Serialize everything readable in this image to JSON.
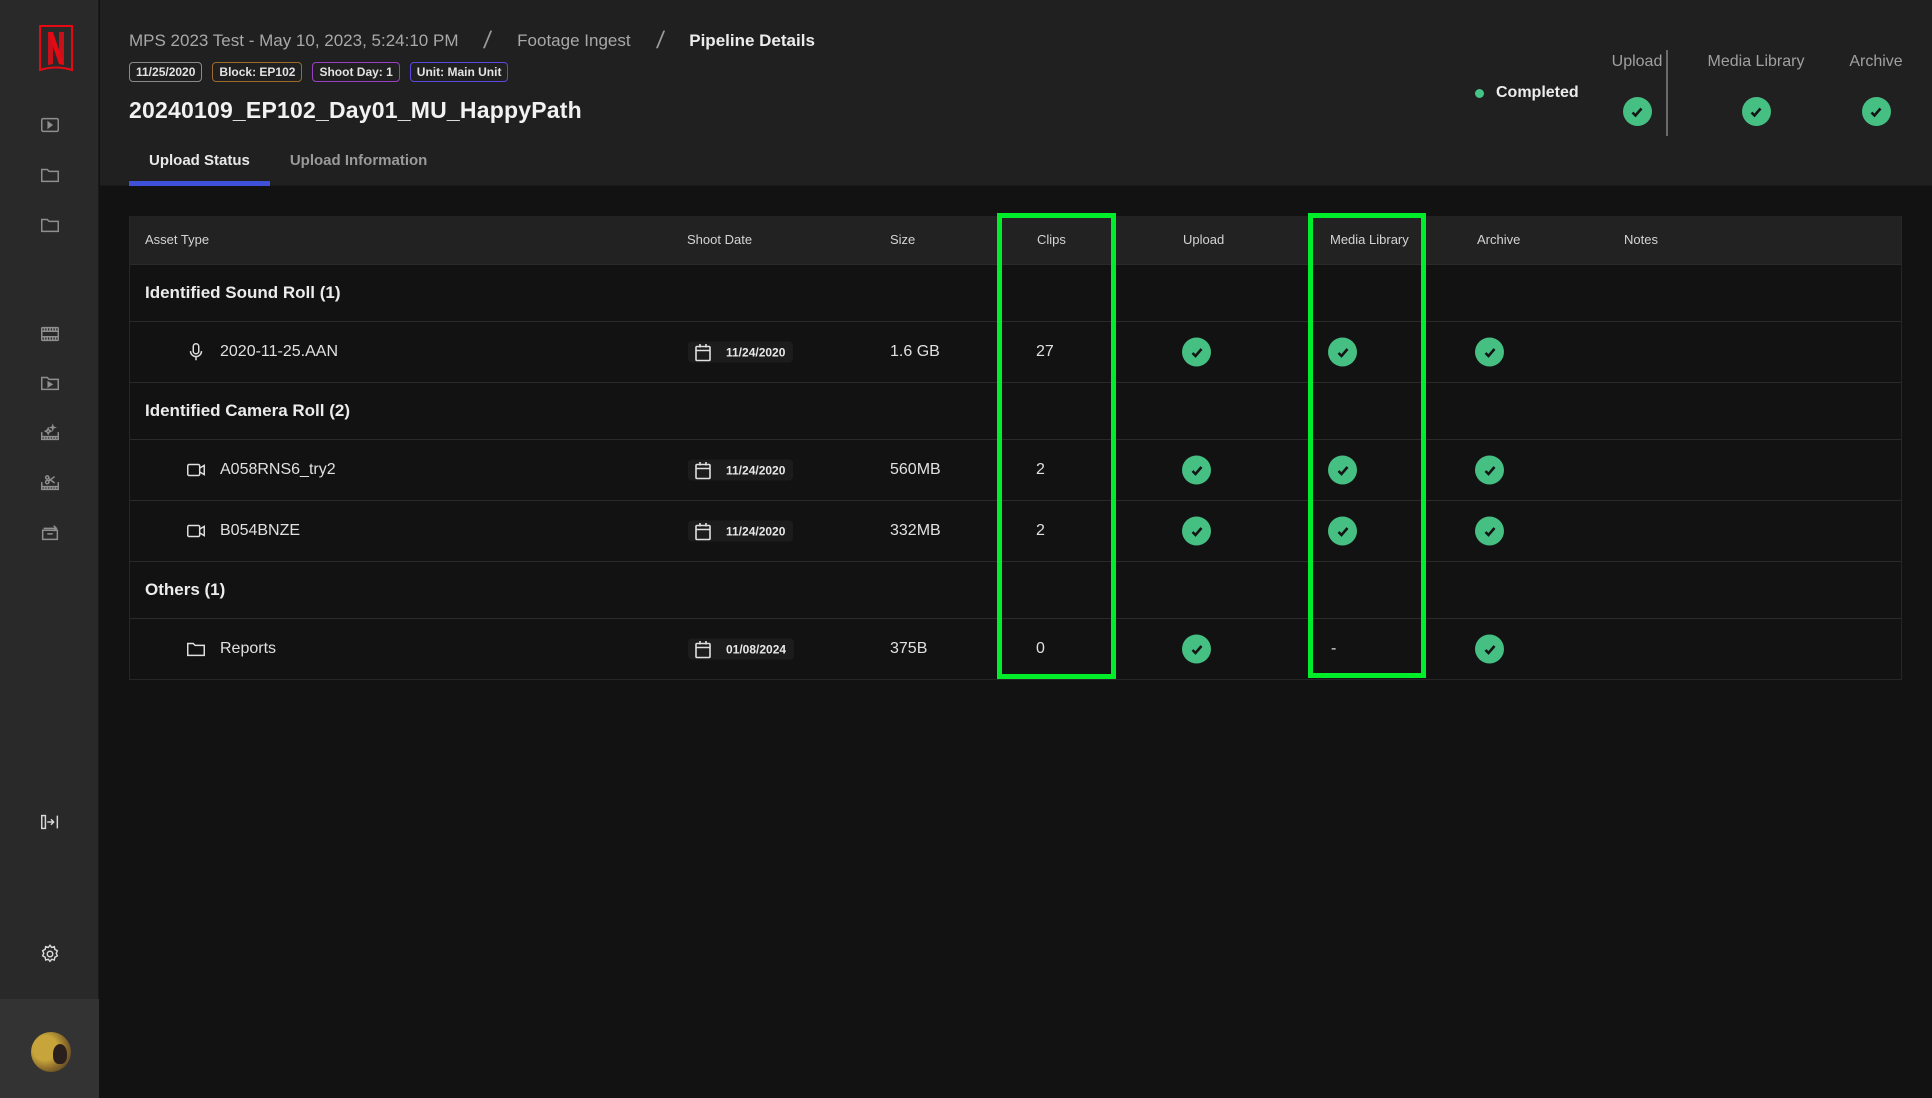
{
  "sidebar": {
    "logo": "netflix-logo",
    "items": [
      {
        "name": "sidebar-item-player",
        "icon": "play-square-icon"
      },
      {
        "name": "sidebar-item-folder-1",
        "icon": "folder-icon"
      },
      {
        "name": "sidebar-item-folder-2",
        "icon": "folder-icon"
      },
      {
        "name": "sidebar-item-film",
        "icon": "film-strip-icon"
      },
      {
        "name": "sidebar-item-media-folder",
        "icon": "folder-play-icon"
      },
      {
        "name": "sidebar-item-vfx",
        "icon": "film-sparkle-icon"
      },
      {
        "name": "sidebar-item-edit",
        "icon": "film-scissors-icon"
      },
      {
        "name": "sidebar-item-archive",
        "icon": "archive-arrow-icon"
      }
    ],
    "expand_icon": "expand-sidebar-icon",
    "settings_icon": "gear-icon",
    "avatar": "user-avatar"
  },
  "header": {
    "breadcrumb": [
      "MPS 2023 Test - May 10, 2023, 5:24:10 PM",
      "Footage Ingest",
      "Pipeline Details"
    ],
    "breadcrumb_separator": "/",
    "badges": [
      {
        "label": "11/25/2020",
        "color": "#8a8a8a"
      },
      {
        "label": "Block: EP102",
        "color": "#9a6a2a"
      },
      {
        "label": "Shoot Day: 1",
        "color": "#9a3fc4"
      },
      {
        "label": "Unit: Main Unit",
        "color": "#5a48e0"
      }
    ],
    "title": "20240109_EP102_Day01_MU_HappyPath",
    "tabs": [
      {
        "label": "Upload Status",
        "active": true
      },
      {
        "label": "Upload Information",
        "active": false
      }
    ],
    "status": {
      "label": "Completed",
      "color": "#44c487"
    },
    "stages": [
      {
        "label": "Upload",
        "state": "complete"
      },
      {
        "label": "Media Library",
        "state": "complete"
      },
      {
        "label": "Archive",
        "state": "complete"
      }
    ]
  },
  "table": {
    "columns": [
      "Asset Type",
      "Shoot Date",
      "Size",
      "Clips",
      "Upload",
      "Media Library",
      "Archive",
      "Notes"
    ],
    "groups": [
      {
        "label": "Identified Sound Roll (1)",
        "items": [
          {
            "icon": "microphone-icon",
            "name": "2020-11-25.AAN",
            "shoot_date": "11/24/2020",
            "size": "1.6 GB",
            "clips": "27",
            "upload": "complete",
            "media_library": "complete",
            "archive": "complete",
            "notes": ""
          }
        ]
      },
      {
        "label": "Identified Camera Roll (2)",
        "items": [
          {
            "icon": "video-camera-icon",
            "name": "A058RNS6_try2",
            "shoot_date": "11/24/2020",
            "size": "560MB",
            "clips": "2",
            "upload": "complete",
            "media_library": "complete",
            "archive": "complete",
            "notes": ""
          },
          {
            "icon": "video-camera-icon",
            "name": "B054BNZE",
            "shoot_date": "11/24/2020",
            "size": "332MB",
            "clips": "2",
            "upload": "complete",
            "media_library": "complete",
            "archive": "complete",
            "notes": ""
          }
        ]
      },
      {
        "label": "Others (1)",
        "items": [
          {
            "icon": "folder-icon",
            "name": "Reports",
            "shoot_date": "01/08/2024",
            "size": "375B",
            "clips": "0",
            "upload": "complete",
            "media_library": "-",
            "archive": "complete",
            "notes": ""
          }
        ]
      }
    ],
    "highlighted_columns": [
      "Clips",
      "Media Library"
    ],
    "highlight_color": "#00ee2a",
    "check_color": "#46bf83"
  }
}
